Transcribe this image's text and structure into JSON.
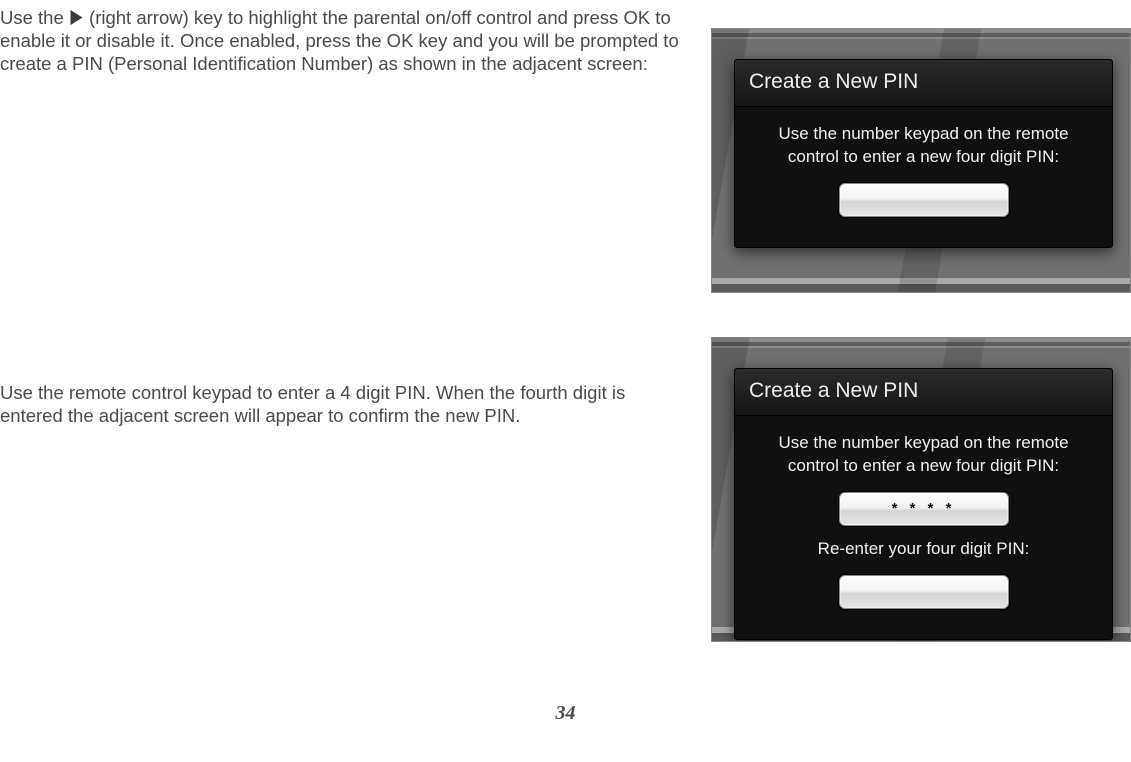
{
  "para1_pre": "Use the ",
  "para1_post": " (right arrow) key to highlight the parental on/off control and press OK to enable it or disable it.  Once enabled, press the OK key and you will be prompted to create a PIN (Personal Identification Number) as shown in the adjacent screen:",
  "para2": "Use the remote control keypad to enter a 4 digit PIN.  When the fourth digit is entered the adjacent screen will appear to confirm the new PIN.",
  "dialog": {
    "title": "Create a New PIN",
    "instruction": "Use the number keypad on the remote control to enter a new four digit PIN:",
    "reenter": "Re-enter your four digit PIN:",
    "pin_masked": "*  *  *  *"
  },
  "page_number": "34"
}
